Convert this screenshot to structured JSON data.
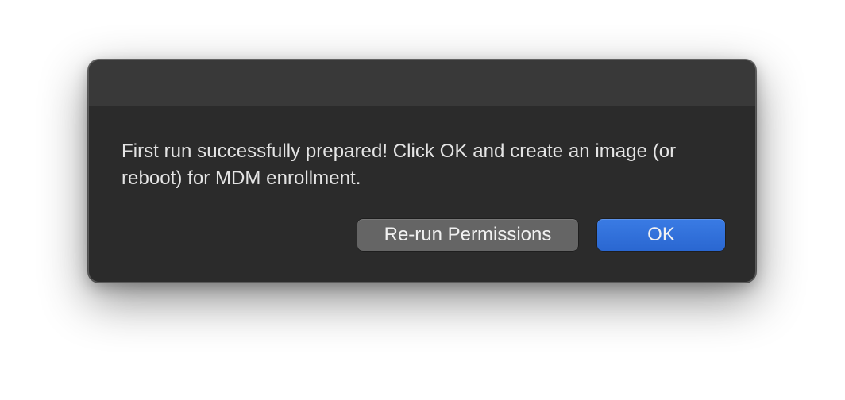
{
  "dialog": {
    "message": "First run successfully prepared! Click OK and create an image (or reboot) for MDM enrollment.",
    "buttons": {
      "secondary_label": "Re-run Permissions",
      "primary_label": "OK"
    },
    "colors": {
      "background": "#2b2b2b",
      "titlebar": "#393939",
      "secondary_button": "#656565",
      "primary_button": "#2f6fd8",
      "text": "#e4e4e4"
    }
  }
}
